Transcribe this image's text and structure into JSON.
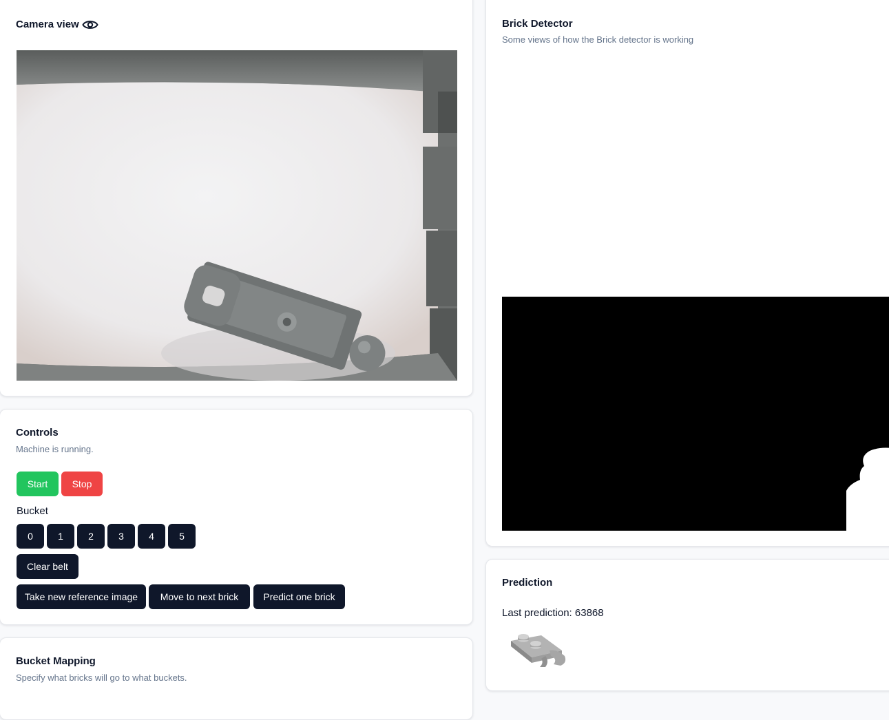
{
  "camera": {
    "title": "Camera view",
    "eye_icon": "eye-icon"
  },
  "controls": {
    "title": "Controls",
    "status": "Machine is running.",
    "start_label": "Start",
    "stop_label": "Stop",
    "bucket_label": "Bucket",
    "buckets": [
      "0",
      "1",
      "2",
      "3",
      "4",
      "5"
    ],
    "clear_belt_label": "Clear belt",
    "take_reference_label": "Take new reference image",
    "move_next_label": "Move to next brick",
    "predict_one_label": "Predict one brick"
  },
  "bucket_mapping": {
    "title": "Bucket Mapping",
    "description": "Specify what bricks will go to what buckets."
  },
  "brick_detector": {
    "title": "Brick Detector",
    "description": "Some views of how the Brick detector is working"
  },
  "prediction": {
    "title": "Prediction",
    "last_prediction": "Last prediction: 63868"
  },
  "colors": {
    "primary": "#0f172a",
    "start": "#22c55e",
    "stop": "#ef4444",
    "muted": "#64748b"
  }
}
